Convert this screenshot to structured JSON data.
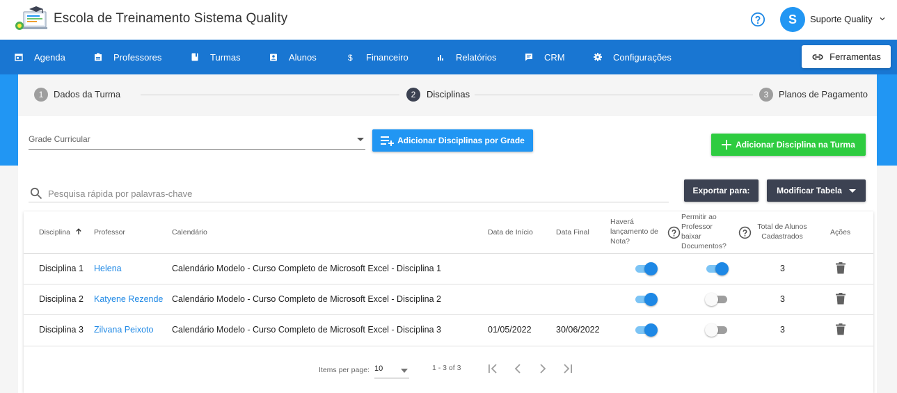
{
  "header": {
    "title": "Escola de Treinamento Sistema Quality",
    "user_initial": "S",
    "user_name": "Suporte Quality"
  },
  "nav": {
    "items": [
      {
        "label": "Agenda",
        "icon": "calendar-icon"
      },
      {
        "label": "Professores",
        "icon": "badge-icon"
      },
      {
        "label": "Turmas",
        "icon": "book-icon"
      },
      {
        "label": "Alunos",
        "icon": "contact-card-icon"
      },
      {
        "label": "Financeiro",
        "icon": "dollar-icon"
      },
      {
        "label": "Relatórios",
        "icon": "bar-chart-icon"
      },
      {
        "label": "CRM",
        "icon": "chat-icon"
      },
      {
        "label": "Configurações",
        "icon": "gear-icon"
      }
    ],
    "tools_label": "Ferramentas"
  },
  "stepper": {
    "steps": [
      {
        "number": "1",
        "label": "Dados da Turma"
      },
      {
        "number": "2",
        "label": "Disciplinas"
      },
      {
        "number": "3",
        "label": "Planos de Pagamento"
      }
    ]
  },
  "form": {
    "grade_label": "Grade Curricular",
    "add_by_grade_label": "Adicionar Disciplinas por Grade",
    "add_discipline_label": "Adicionar Disciplina na Turma",
    "search_placeholder": "Pesquisa rápida por palavras-chave",
    "export_label": "Exportar para:",
    "modify_table_label": "Modificar Tabela"
  },
  "table": {
    "columns": {
      "disciplina": "Disciplina",
      "professor": "Professor",
      "calendario": "Calendário",
      "data_inicio": "Data de Início",
      "data_final": "Data Final",
      "nota_1": "Haverá",
      "nota_2": "lançamento de",
      "nota_3": "Nota?",
      "docs_1": "Permitir ao",
      "docs_2": "Professor",
      "docs_3": "baixar",
      "docs_4": "Documentos?",
      "alunos_1": "Total de Alunos",
      "alunos_2": "Cadastrados",
      "acoes": "Ações"
    },
    "rows": [
      {
        "disciplina": "Disciplina 1",
        "professor": "Helena",
        "calendario": "Calendário Modelo - Curso Completo de Microsoft Excel - Disciplina 1",
        "data_inicio": "",
        "data_final": "",
        "nota": true,
        "docs": true,
        "alunos": "3"
      },
      {
        "disciplina": "Disciplina 2",
        "professor": "Katyene Rezende",
        "calendario": "Calendário Modelo - Curso Completo de Microsoft Excel - Disciplina 2",
        "data_inicio": "",
        "data_final": "",
        "nota": true,
        "docs": false,
        "alunos": "3"
      },
      {
        "disciplina": "Disciplina 3",
        "professor": "Zilvana Peixoto",
        "calendario": "Calendário Modelo - Curso Completo de Microsoft Excel - Disciplina 3",
        "data_inicio": "01/05/2022",
        "data_final": "30/06/2022",
        "nota": true,
        "docs": false,
        "alunos": "3"
      }
    ]
  },
  "paginator": {
    "items_per_page_label": "Items per page:",
    "items_per_page_value": "10",
    "range_label": "1 - 3 of 3"
  },
  "colors": {
    "nav": "#1976d2",
    "accent_blue": "#2196f3",
    "green": "#2ecc40",
    "dark": "#3c4252",
    "link": "#1e88e5"
  }
}
